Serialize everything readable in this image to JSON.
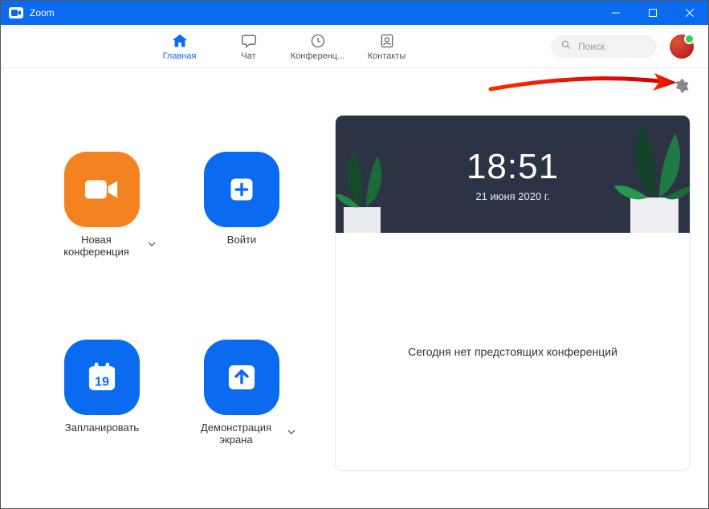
{
  "title": "Zoom",
  "tabs": {
    "home": "Главная",
    "chat": "Чат",
    "meetings": "Конференц...",
    "contacts": "Контакты"
  },
  "search": {
    "placeholder": "Поиск"
  },
  "actions": {
    "new_meeting": "Новая конференция",
    "join": "Войти",
    "schedule": "Запланировать",
    "schedule_day": "19",
    "share": "Демонстрация экрана"
  },
  "clock": {
    "time": "18:51",
    "date": "21 июня 2020 г."
  },
  "card": {
    "empty": "Сегодня нет предстоящих конференций"
  }
}
